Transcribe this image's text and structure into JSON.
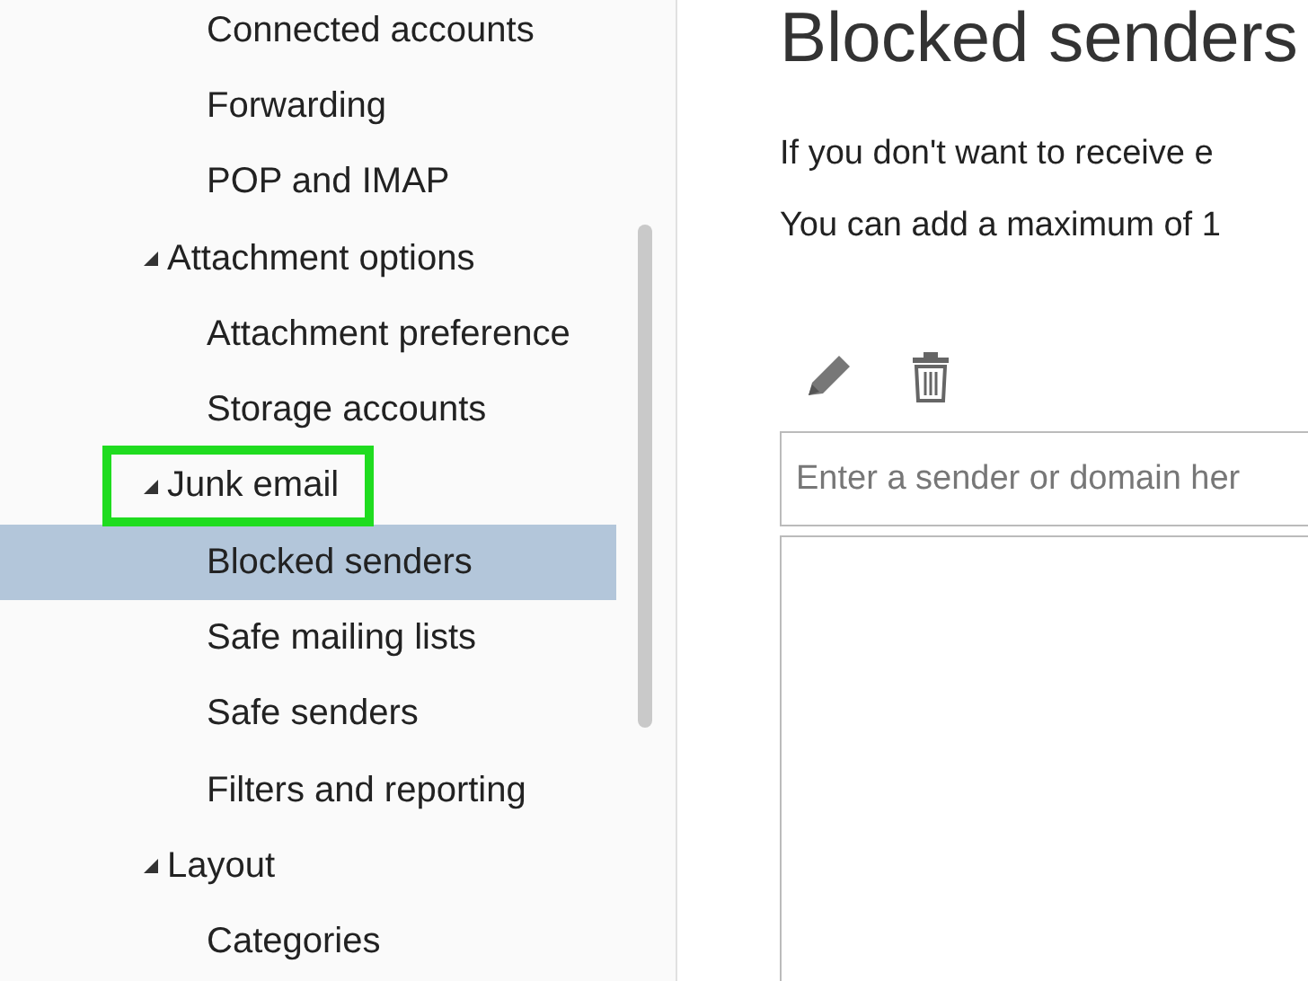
{
  "sidebar": {
    "groups": [
      {
        "children": [
          {
            "label": "Connected accounts",
            "selected": false
          },
          {
            "label": "Forwarding",
            "selected": false
          },
          {
            "label": "POP and IMAP",
            "selected": false
          }
        ]
      },
      {
        "label": "Attachment options",
        "expanded": true,
        "children": [
          {
            "label": "Attachment preference",
            "selected": false
          },
          {
            "label": "Storage accounts",
            "selected": false
          }
        ]
      },
      {
        "label": "Junk email",
        "expanded": true,
        "highlighted": true,
        "children": [
          {
            "label": "Blocked senders",
            "selected": true
          },
          {
            "label": "Safe mailing lists",
            "selected": false
          },
          {
            "label": "Safe senders",
            "selected": false
          },
          {
            "label": "Filters and reporting",
            "selected": false
          }
        ]
      },
      {
        "label": "Layout",
        "expanded": true,
        "children": [
          {
            "label": "Categories",
            "selected": false
          }
        ]
      }
    ]
  },
  "content": {
    "title": "Blocked senders",
    "paragraphs": [
      "If you don't want to receive e",
      "You can add a maximum of 1"
    ],
    "sender_field": {
      "placeholder": "Enter a sender or domain her"
    }
  }
}
